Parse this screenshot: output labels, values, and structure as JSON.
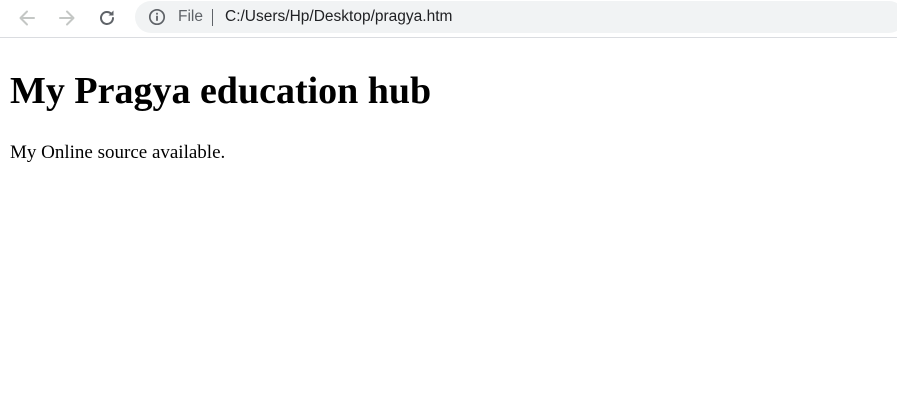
{
  "browser": {
    "nav": {
      "back_icon": "arrow-left-icon",
      "forward_icon": "arrow-right-icon",
      "reload_icon": "reload-icon"
    },
    "omnibox": {
      "security_icon": "info-circle-icon",
      "scheme_label": "File",
      "url": "C:/Users/Hp/Desktop/pragya.htm"
    }
  },
  "page": {
    "heading": "My Pragya education hub",
    "paragraph": "My Online source available."
  },
  "colors": {
    "icon_disabled": "#c4c7c5",
    "icon_active": "#5f6368",
    "omnibox_bg": "#f1f3f4",
    "url_text": "#202124"
  }
}
